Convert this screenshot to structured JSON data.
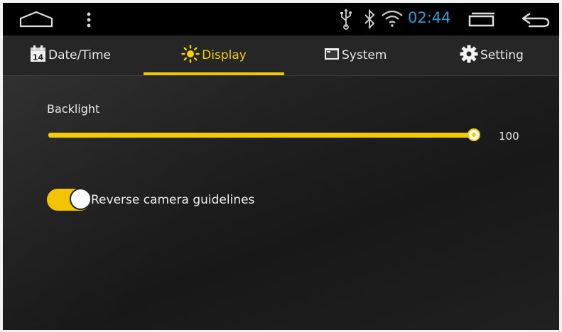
{
  "status_bar": {
    "time": "02:44",
    "time_color": "#2b9ed8",
    "icons": [
      "home-icon",
      "menu-icon",
      "usb-icon",
      "bluetooth-icon",
      "wifi-icon",
      "recent-apps-icon",
      "back-icon"
    ]
  },
  "tabs": [
    {
      "label": "Date/Time",
      "icon": "calendar-icon",
      "icon_text": "14",
      "active": false
    },
    {
      "label": "Display",
      "icon": "sun-icon",
      "active": true
    },
    {
      "label": "System",
      "icon": "system-icon",
      "active": false
    },
    {
      "label": "Setting",
      "icon": "gear-icon",
      "active": false
    }
  ],
  "accent_color": "#f2cc00",
  "backlight": {
    "label": "Backlight",
    "value": "100",
    "level_fraction": 1.0
  },
  "reverse_camera": {
    "label": "Reverse camera guidelines",
    "enabled": true
  }
}
